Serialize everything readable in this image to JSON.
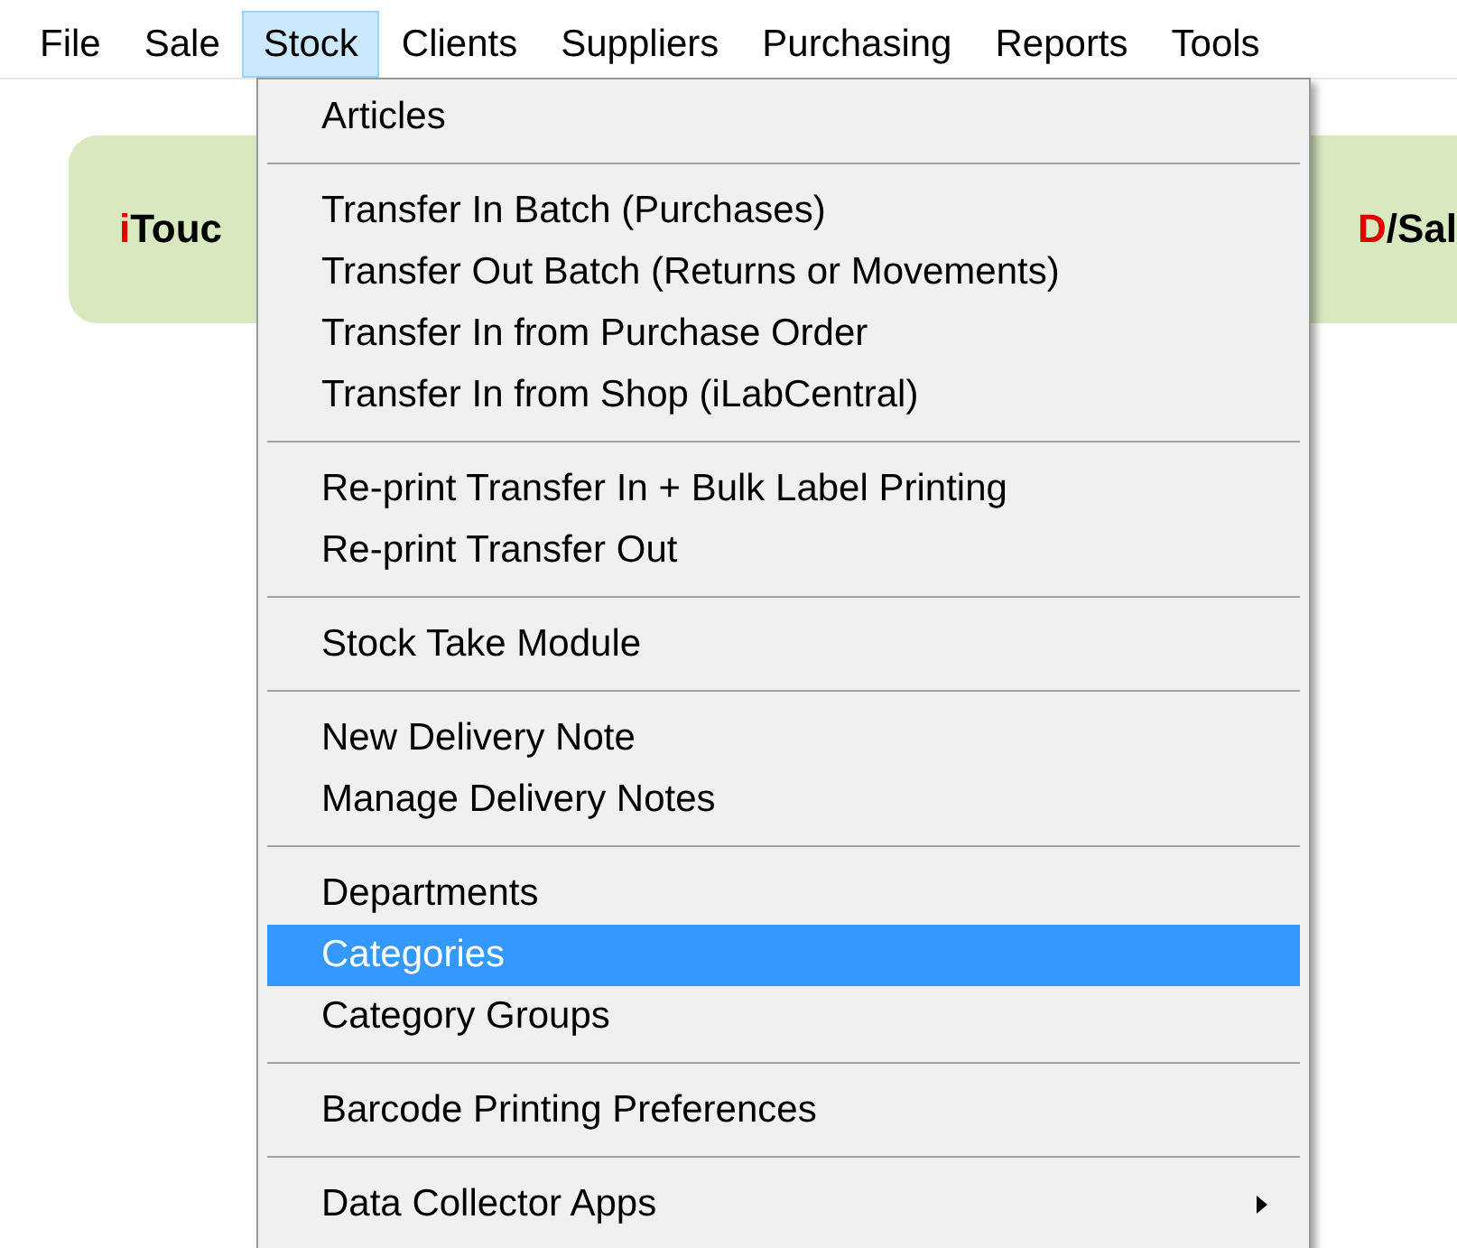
{
  "menubar": [
    {
      "label": "File",
      "selected": false
    },
    {
      "label": "Sale",
      "selected": false
    },
    {
      "label": "Stock",
      "selected": true
    },
    {
      "label": "Clients",
      "selected": false
    },
    {
      "label": "Suppliers",
      "selected": false
    },
    {
      "label": "Purchasing",
      "selected": false
    },
    {
      "label": "Reports",
      "selected": false
    },
    {
      "label": "Tools",
      "selected": false
    }
  ],
  "banner": {
    "left": [
      {
        "text": "i",
        "accent": true
      },
      {
        "text": "Touc",
        "accent": false
      }
    ],
    "right": [
      {
        "text": "D",
        "accent": true
      },
      {
        "text": "/Sal",
        "accent": false
      }
    ]
  },
  "menu": {
    "groups": [
      [
        {
          "label": "Articles",
          "selected": false,
          "submenu": false
        }
      ],
      [
        {
          "label": "Transfer In Batch (Purchases)",
          "selected": false,
          "submenu": false
        },
        {
          "label": "Transfer Out Batch (Returns or Movements)",
          "selected": false,
          "submenu": false
        },
        {
          "label": "Transfer In from Purchase Order",
          "selected": false,
          "submenu": false
        },
        {
          "label": "Transfer In from Shop (iLabCentral)",
          "selected": false,
          "submenu": false
        }
      ],
      [
        {
          "label": "Re-print Transfer In + Bulk Label Printing",
          "selected": false,
          "submenu": false
        },
        {
          "label": "Re-print Transfer Out",
          "selected": false,
          "submenu": false
        }
      ],
      [
        {
          "label": "Stock Take Module",
          "selected": false,
          "submenu": false
        }
      ],
      [
        {
          "label": "New Delivery Note",
          "selected": false,
          "submenu": false
        },
        {
          "label": "Manage Delivery Notes",
          "selected": false,
          "submenu": false
        }
      ],
      [
        {
          "label": "Departments",
          "selected": false,
          "submenu": false
        },
        {
          "label": "Categories",
          "selected": true,
          "submenu": false
        },
        {
          "label": "Category Groups",
          "selected": false,
          "submenu": false
        }
      ],
      [
        {
          "label": "Barcode Printing Preferences",
          "selected": false,
          "submenu": false
        }
      ],
      [
        {
          "label": "Data Collector Apps",
          "selected": false,
          "submenu": true
        }
      ]
    ]
  }
}
